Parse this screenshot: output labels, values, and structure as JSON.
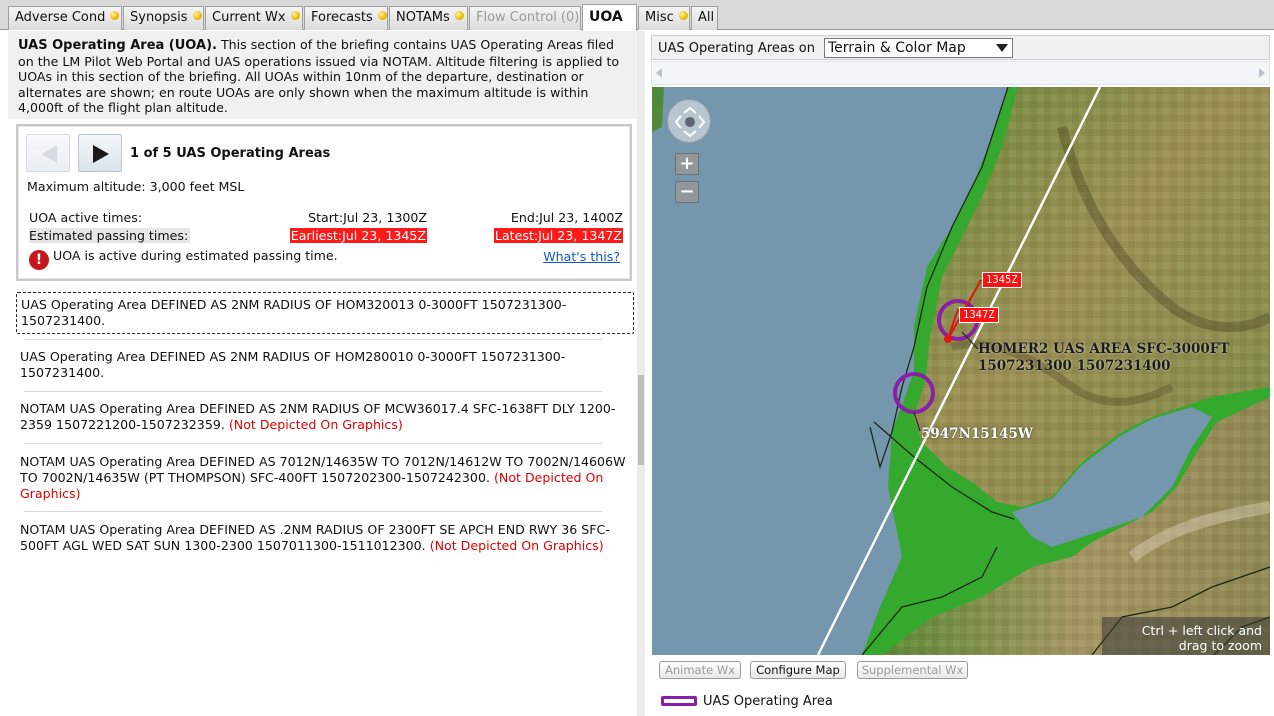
{
  "tabs": [
    {
      "label": "Adverse Cond",
      "dot": true,
      "state": "normal"
    },
    {
      "label": "Synopsis",
      "dot": true,
      "state": "normal"
    },
    {
      "label": "Current Wx",
      "dot": true,
      "state": "normal"
    },
    {
      "label": "Forecasts",
      "dot": true,
      "state": "normal"
    },
    {
      "label": "NOTAMs",
      "dot": true,
      "state": "normal"
    },
    {
      "label": "Flow Control (0)",
      "dot": false,
      "state": "disabled"
    },
    {
      "label": "UOA",
      "dot": false,
      "state": "active"
    },
    {
      "label": "Misc",
      "dot": true,
      "state": "normal"
    },
    {
      "label": "All",
      "dot": false,
      "state": "normal"
    }
  ],
  "intro": {
    "heading": "UAS Operating Area (UOA).",
    "body": " This section of the briefing contains UAS Operating Areas filed on the LM Pilot Web Portal and UAS operations issued via NOTAM. Altitude filtering is applied to UOAs in this section of the briefing. All UOAs within 10nm of the departure, destination or alternates are shown; en route UOAs are only shown when the maximum altitude is within 4,000ft of the flight plan altitude."
  },
  "uoa_panel": {
    "pager": "1 of 5 UAS Operating Areas",
    "max_altitude": "Maximum altitude: 3,000 feet MSL",
    "active_label": "UOA active times:",
    "active_start": "Start:Jul 23, 1300Z",
    "active_end": "End:Jul 23, 1400Z",
    "passing_label": "Estimated passing times:",
    "passing_earliest": "Earliest:Jul 23, 1345Z",
    "passing_latest": "Latest:Jul 23, 1347Z",
    "warning": "UOA is active during estimated passing time.",
    "whats_this": "What's this?"
  },
  "items": [
    {
      "text": "UAS Operating Area DEFINED AS 2NM RADIUS OF HOM320013 0-3000FT 1507231300-1507231400.",
      "note": ""
    },
    {
      "text": "UAS Operating Area DEFINED AS 2NM RADIUS OF HOM280010 0-3000FT 1507231300-1507231400.",
      "note": ""
    },
    {
      "text": "NOTAM UAS Operating Area DEFINED AS 2NM RADIUS OF MCW36017.4 SFC-1638FT DLY 1200-2359 1507221200-1507232359.",
      "note": "(Not Depicted On Graphics)"
    },
    {
      "text": "NOTAM UAS Operating Area DEFINED AS 7012N/14635W TO 7012N/14612W TO 7002N/14606W TO 7002N/14635W (PT THOMPSON) SFC-400FT 1507202300-1507242300.",
      "note": "(Not Depicted On Graphics)"
    },
    {
      "text": "NOTAM UAS Operating Area DEFINED AS .2NM RADIUS OF 2300FT SE APCH END RWY 36 SFC-500FT AGL WED SAT SUN 1300-2300 1507011300-1511012300.",
      "note": "(Not Depicted On Graphics)"
    }
  ],
  "map": {
    "header_label": "UAS Operating Areas on",
    "layer_select": "Terrain & Color Map",
    "zoom_in": "+",
    "zoom_out": "−",
    "flag_1345": "1345Z",
    "flag_1347": "1347Z",
    "label_homer2_line1": "HOMER2 UAS AREA SFC-3000FT",
    "label_homer2_line2": "1507231300 1507231400",
    "label_point": "5947N15145W",
    "hint_line1": "Ctrl + left click and",
    "hint_line2": "drag to zoom",
    "buttons": {
      "animate": "Animate Wx",
      "configure": "Configure Map",
      "supplemental": "Supplemental Wx"
    },
    "legend": "UAS Operating Area",
    "colors": {
      "uoa": "#8a1fa8",
      "water": "#7597ad",
      "flag": "#ff1111"
    }
  }
}
